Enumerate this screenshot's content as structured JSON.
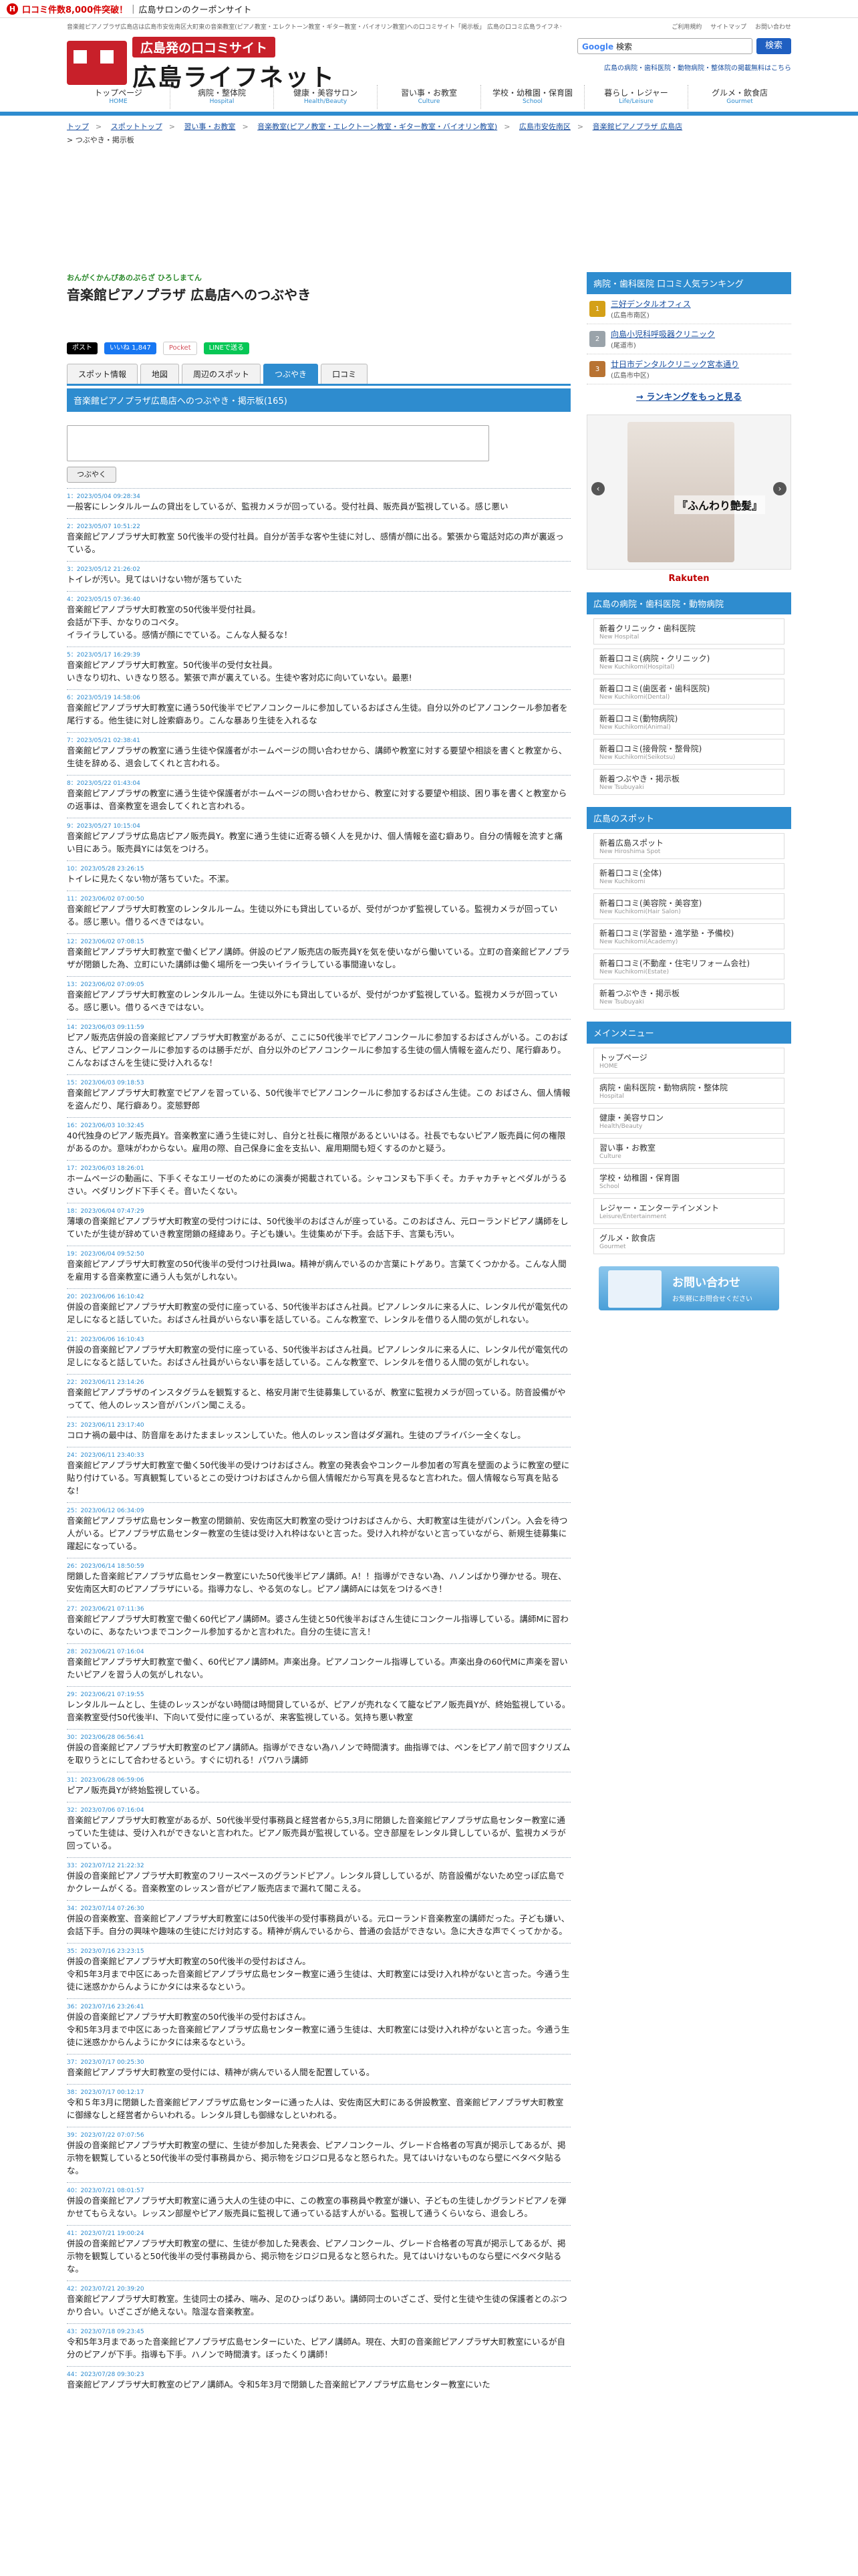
{
  "promo": {
    "text": "口コミ件数8,000件突破！",
    "sep": "|",
    "coupon": "広島サロンのクーポンサイト"
  },
  "header": {
    "desc": "音楽館ピアノプラザ広島店は広島市安佐南区大町東の音楽教室(ピアノ教室・エレクトーン教室・ギター教室・バイオリン教室)への口コミサイト「掲示板」 広島の口コミ広島ライフネット",
    "toplinks": [
      "ご利用規約",
      "サイトマップ",
      "お問い合わせ"
    ],
    "logo_tag": "広島発の口コミサイト",
    "logo_name": "広島ライフネット",
    "search_brand": "Google",
    "search_placeholder": "検索",
    "search_button": "検索",
    "hotlinks": "広島の病院・歯科医院・動物病院・整体院の掲載無料はこちら"
  },
  "gnav": [
    {
      "jp": "トップページ",
      "en": "HOME"
    },
    {
      "jp": "病院・整体院",
      "en": "Hospital"
    },
    {
      "jp": "健康・美容サロン",
      "en": "Health/Beauty"
    },
    {
      "jp": "習い事・お教室",
      "en": "Culture"
    },
    {
      "jp": "学校・幼稚園・保育園",
      "en": "School"
    },
    {
      "jp": "暮らし・レジャー",
      "en": "Life/Leisure"
    },
    {
      "jp": "グルメ・飲食店",
      "en": "Gourmet"
    }
  ],
  "breadcrumb": [
    "トップ",
    "スポットトップ",
    "習い事・お教室",
    "音楽教室(ピアノ教室・エレクトーン教室・ギター教室・バイオリン教室)",
    "広島市安佐南区",
    "音楽館ピアノプラザ 広島店"
  ],
  "breadcrumb_current": "つぶやき・掲示板",
  "breadcrumb_sep": ">",
  "page": {
    "kana": "おんがくかんぴあのぷらざ ひろしまてん",
    "title": "音楽館ピアノプラザ 広島店へのつぶやき"
  },
  "social": {
    "x": "ポスト",
    "fb": "いいね 1,847",
    "pocket": "Pocket",
    "line": "LINEで送る"
  },
  "tabs": [
    "スポット情報",
    "地図",
    "周辺のスポット",
    "つぶやき",
    "口コミ"
  ],
  "board": {
    "heading": "音楽館ピアノプラザ広島店へのつぶやき・掲示板(165)",
    "post_button": "つぶやく"
  },
  "posts": [
    {
      "meta": "1：2023/05/04 09:28:34",
      "body": "一般客にレンタルルームの貸出をしているが、監視カメラが回っている。受付社員、販売員が監視している。感じ悪い"
    },
    {
      "meta": "2：2023/05/07 10:51:22",
      "body": "音楽館ピアノプラザ大町教室 50代後半の受付社員。自分が苦手な客や生徒に対し、感情が顔に出る。繁張から電話対応の声が裏返っている。"
    },
    {
      "meta": "3：2023/05/12 21:26:02",
      "body": "トイレが汚い。見てはいけない物が落ちていた"
    },
    {
      "meta": "4：2023/05/15 07:36:40",
      "body": "音楽館ピアノプラザ大町教室の50代後半受付社員。\n会話が下手、かなりのコペタ。\nイライラしている。感情が顔にでている。こんな人擬るな！"
    },
    {
      "meta": "5：2023/05/17 16:29:39",
      "body": "音楽館ピアノプラザ大町教室。50代後半の受付女社員。\nいきなり切れ、いきなり怒る。繁張で声が裏えている。生徒や客対応に向いていない。最悪!"
    },
    {
      "meta": "6：2023/05/19 14:58:06",
      "body": "音楽館ピアノプラザ大町教室に通う50代後半でピアノコンクールに参加しているおばさん生徒。自分以外のピアノコンクール参加者を尾行する。他生徒に対し詮索癖あり。こんな暴あり生徒を入れるな"
    },
    {
      "meta": "7：2023/05/21 02:38:41",
      "body": "音楽館ピアノプラザの教室に通う生徒や保護者がホームページの問い合わせから、講師や教室に対する要望や相談を書くと教室から、生徒を辞める、退会してくれと言われる。"
    },
    {
      "meta": "8：2023/05/22 01:43:04",
      "body": "音楽館ピアノプラザの教室に通う生徒や保護者がホームページの問い合わせから、教室に対する要望や相談、困り事を書くと教室から の返事は、音楽教室を退会してくれと言われる。"
    },
    {
      "meta": "9：2023/05/27 10:15:04",
      "body": "音楽館ピアノプラザ広島店ピアノ販売員Y。教室に通う生徒に近寄る頓く人を見かけ、個人情報を盗む癖あり。自分の情報を流すと痛い目にあう。販売員Yには気をつけろ。"
    },
    {
      "meta": "10：2023/05/28 23:26:15",
      "body": "トイレに見たくない物が落ちていた。不潔。"
    },
    {
      "meta": "11：2023/06/02 07:00:50",
      "body": "音楽館ピアノプラザ大町教室のレンタルルーム。生徒以外にも貸出しているが、受付がつかず監視している。監視カメラが回っている。感じ悪い。借りるべきではない。"
    },
    {
      "meta": "12：2023/06/02 07:08:15",
      "body": "音楽館ピアノプラザ大町教室で働くピアノ講師。併設のピアノ販売店の販売員Yを気を使いながら働いている。立町の音楽館ピアノプラザが閉鎖した為、立町にいた講師は働く場所を一つ失いイライラしている事間違いなし。"
    },
    {
      "meta": "13：2023/06/02 07:09:05",
      "body": "音楽館ピアノプラザ大町教室のレンタルルーム。生徒以外にも貸出しているが、受付がつかず監視している。監視カメラが回っている。感じ悪い。借りるべきではない。"
    },
    {
      "meta": "14：2023/06/03 09:11:59",
      "body": "ピアノ販売店併設の音楽館ピアノプラザ大町教室があるが、ここに50代後半でピアノコンクールに参加するおばさんがいる。このおばさん、ピアノコンクールに参加するのは勝手だが、自分以外のピアノコンクールに参加する生徒の個人情報を盗んだり、尾行癖あり。こんなおばさんを生徒に受け入れるな！"
    },
    {
      "meta": "15：2023/06/03 09:18:53",
      "body": "音楽館ピアノプラザ大町教室でピアノを習っている、50代後半でピアノコンクールに参加するおばさん生徒。この おばさん、個人情報を盗んだり、尾行癖あり。変態野郎"
    },
    {
      "meta": "16：2023/06/03 10:32:45",
      "body": "40代独身のピアノ販売員Y。音楽教室に通う生徒に対し、自分と社長に権限があるといいはる。社長でもないピアノ販売員に何の権限があるのか。意味がわからない。雇用の際、自己保身に金を支払い、雇用期間も短くするのかと疑う。"
    },
    {
      "meta": "17：2023/06/03 18:26:01",
      "body": "ホームページの動画に、下手くそなエリーゼのためにの演奏が掲載されている。シャコンヌも下手くそ。カチャカチャとペダルがうるさい。ペダリングド下手くそ。音いたくない。"
    },
    {
      "meta": "18：2023/06/04 07:47:29",
      "body": "薄壊の音楽館ピアノプラザ大町教室の受付つけには、50代後半のおばさんが座っている。このおばさん、元ローランドピアノ講師をしていたが生徒が辞めていき教室閉鎖の経緯あり。子ども嫌い。生徒集めが下手。会話下手、言葉も汚い。"
    },
    {
      "meta": "19：2023/06/04 09:52:50",
      "body": "音楽館ピアノプラザ大町教室の50代後半の受付つけ社員Iwa。精神が病んでいるのか言葉にトゲあり。言葉てくつかかる。こんな人間を雇用する音楽教室に通う人も気がしれない。"
    },
    {
      "meta": "20：2023/06/06 16:10:42",
      "body": "併設の音楽館ピアノプラザ大町教室の受付に座っている、50代後半おばさん社員。ピアノレンタルに来る人に、レンタル代が電気代の足しになると話していた。おばさん社員がいらない事を話している。こんな教室で、レンタルを借りる人間の気がしれない。"
    },
    {
      "meta": "21：2023/06/06 16:10:43",
      "body": "併設の音楽館ピアノプラザ大町教室の受付に座っている、50代後半おばさん社員。ピアノレンタルに来る人に、レンタル代が電気代の足しになると話していた。おばさん社員がいらない事を話している。こんな教室で、レンタルを借りる人間の気がしれない。"
    },
    {
      "meta": "22：2023/06/11 23:14:26",
      "body": "音楽館ピアノプラザのインスタグラムを観覧すると、格安月謝で生徒募集しているが、教室に監視カメラが回っている。防音設備がやってて、他人のレッスン音がバンバン聞こえる。"
    },
    {
      "meta": "23：2023/06/11 23:17:40",
      "body": "コロナ禍の最中は、防音扉をあけたままレッスンしていた。他人のレッスン音はダダ漏れ。生徒のプライバシー全くなし。"
    },
    {
      "meta": "24：2023/06/11 23:40:33",
      "body": "音楽館ピアノプラザ大町教室で働く50代後半の受けつけおばさん。教室の発表会やコンクール参加者の写真を壁面のように教室の壁に貼り付けている。写真観覧しているとこの受けつけおばさんから個人情報だから写真を見るなと言われた。個人情報なら写真を貼るな！"
    },
    {
      "meta": "25：2023/06/12 06:34:09",
      "body": "音楽館ピアノプラザ広島センター教室の閉鎖前、安佐南区大町教室の受けつけおばさんから、大町教室は生徒がパンパン。入会を待つ人がいる。ピアノプラザ広島センター教室の生徒は受け入れ枠はないと言った。受け入れ枠がないと言っていながら、新規生徒募集に躍起になっている。"
    },
    {
      "meta": "26：2023/06/14 18:50:59",
      "body": "閉鎖した音楽館ピアノプラザ広島センター教室にいた50代後半ピアノ講師。A！！指導ができない為、ハノンばかり弾かせる。現在、安佐南区大町のピアノプラザにいる。指導力なし、やる気のなし。ピアノ講師Aには気をつけるべき！"
    },
    {
      "meta": "27：2023/06/21 07:11:36",
      "body": "音楽館ピアノプラザ大町教室で働く60代ピアノ講師M。婆さん生徒と50代後半おばさん生徒にコンクール指導している。講師Mに習わないのに、あなたいつまでコンクール参加するかと言われた。自分の生徒に言え！"
    },
    {
      "meta": "28：2023/06/21 07:16:04",
      "body": "音楽館ピアノプラザ大町教室で働く、60代ピアノ講師M。声楽出身。ピアノコンクール指導している。声楽出身の60代Mに声楽を習いたいピアノを習う人の気がしれない。"
    },
    {
      "meta": "29：2023/06/21 07:19:55",
      "body": "レンタルルームとし、生徒のレッスンがない時間は時間貸しているが、ピアノが売れなくて籠なピアノ販売員Yが、終始監視している。音楽教室受付50代後半I、下向いて受付に座っているが、来客監視している。気持ち悪い教室"
    },
    {
      "meta": "30：2023/06/28 06:56:41",
      "body": "併設の音楽館ピアノプラザ大町教室のピアノ講師A。指導ができない為ハノンで時間潰す。曲指導では、ペンをピアノ前で回すクリズムを取りうとにして合わせるという。すぐに切れる！パワハラ講師"
    },
    {
      "meta": "31：2023/06/28 06:59:06",
      "body": "ピアノ販売員Yが終始監視している。"
    },
    {
      "meta": "32：2023/07/06 07:16:04",
      "body": "音楽館ピアノプラザ大町教室があるが、50代後半受付事務員と経営者から5,3月に閉鎖した音楽館ピアノプラザ広島センター教室に通っていた生徒は、受け入れができないと言われた。ピアノ販売員が監視している。空き部屋をレンタル貸ししているが、監視カメラが回っている。"
    },
    {
      "meta": "33：2023/07/12 21:22:32",
      "body": "併設の音楽館ピアノプラザ大町教室のフリースペースのグランドピアノ。レンタル貸ししているが、防音設備がないため空っぽ広島でかクレームがくる。音楽教室のレッスン音がピアノ販売店まで漏れて聞こえる。"
    },
    {
      "meta": "34：2023/07/14 07:26:30",
      "body": "併設の音楽教室、音楽館ピアノプラザ大町教室には50代後半の受付事務員がいる。元ローランド音楽教室の講師だった。子ども嫌い、会話下手。自分の興味や趣味の生徒にだけ対応する。精神が病んでいるから、普通の会話ができない。急に大きな声でくってかかる。"
    },
    {
      "meta": "35：2023/07/16 23:23:15",
      "body": "併設の音楽館ピアノプラザ大町教室の50代後半の受付おばさん。\n令和5年3月まで中区にあった音楽館ピアノプラザ広島センター教室に通う生徒は、大町教室には受け入れ枠がないと言った。今通う生徒に迷惑かからんようにかタには来るなという。"
    },
    {
      "meta": "36：2023/07/16 23:26:41",
      "body": "併設の音楽館ピアノプラザ大町教室の50代後半の受付おばさん。\n令和5年3月まで中区にあった音楽館ピアノプラザ広島センター教室に通う生徒は、大町教室には受け入れ枠がないと言った。今通う生徒に迷惑かからんようにかタには来るなという。"
    },
    {
      "meta": "37：2023/07/17 00:25:30",
      "body": "音楽館ピアノプラザ大町教室の受付には、精神が病んでいる人間を配置している。"
    },
    {
      "meta": "38：2023/07/17 00:12:17",
      "body": "令和５年3月に閉鎖した音楽館ピアノプラザ広島センターに通った人は、安佐南区大町にある併設教室、音楽館ピアノプラザ大町教室に御縁なしと経営者からいわれる。レンタル貸しも御縁なしといわれる。"
    },
    {
      "meta": "39：2023/07/22 07:07:56",
      "body": "併設の音楽館ピアノプラザ大町教室の壁に、生徒が参加した発表会、ピアノコンクール、グレード合格者の写真が掲示してあるが、掲示物を観覧していると50代後半の受付事務員から、掲示物をジロジロ見るなと怒られた。見てはいけないものなら壁にベタベタ貼るな。"
    },
    {
      "meta": "40：2023/07/21 08:01:57",
      "body": "併設の音楽館ピアノプラザ大町教室に通う大人の生徒の中に、この教室の事務員や教室が嫌い、子どもの生徒しかグランドピアノを弾かせてもらえない。レッスン部屋やピアノ販売員に監視して通っている話す人がいる。監視して通うくらいなら、退会しろ。"
    },
    {
      "meta": "41：2023/07/21 19:00:24",
      "body": "併設の音楽館ピアノプラザ大町教室の壁に、生徒が参加した発表会、ピアノコンクール、グレード合格者の写真が掲示してあるが、掲示物を観覧していると50代後半の受付事務員から、掲示物をジロジロ見るなと怒られた。見てはいけないものなら壁にベタベタ貼るな。"
    },
    {
      "meta": "42：2023/07/21 20:39:20",
      "body": "音楽館ピアノプラザ大町教室。生徒同士の揉み、喘み、足のひっぱりあい。講師同士のいざこざ、受付と生徒や生徒の保護者とのぶつかり合い。いざこざが絶えない。陰湿な音楽教室。"
    },
    {
      "meta": "43：2023/07/18 09:23:45",
      "body": "令和5年3月まであった音楽館ピアノプラザ広島センターにいた、ピアノ講師A。現在、大町の音楽館ピアノプラザ大町教室にいるが自分のピアノが下手。指導も下手。ハノンで時間潰す。ぼったくり講師！"
    },
    {
      "meta": "44：2023/07/28 09:30:23",
      "body": "音楽館ピアノプラザ大町教室のピアノ講師A。令和5年3月で閉鎖した音楽館ピアノプラザ広島センター教室にいた"
    }
  ],
  "side": {
    "ranking_head": "病院・歯科医院 口コミ人気ランキング",
    "ranking": [
      {
        "name": "三好デンタルオフィス",
        "area": "(広島市南区)",
        "color": "#d4a017"
      },
      {
        "name": "向島小児科呼吸器クリニック",
        "area": "(尾道市)",
        "color": "#9aa3aa"
      },
      {
        "name": "廿日市デンタルクリニック宮本通り",
        "area": "(広島市中区)",
        "color": "#b87333"
      }
    ],
    "ranking_more": "→ ランキングをもっと見る",
    "ad_text": "『ふんわり艶髪』",
    "rakuten": "Rakuten",
    "recent_head": "広島の病院・歯科医院・動物病院",
    "recent": [
      {
        "jp": "新着クリニック・歯科医院",
        "en": "New Hospital"
      },
      {
        "jp": "新着口コミ(病院・クリニック)",
        "en": "New Kuchikomi(Hospital)"
      },
      {
        "jp": "新着口コミ(歯医者・歯科医院)",
        "en": "New Kuchikomi(Dental)"
      },
      {
        "jp": "新着口コミ(動物病院)",
        "en": "New Kuchikomi(Animal)"
      },
      {
        "jp": "新着口コミ(接骨院・整骨院)",
        "en": "New Kuchikomi(Seikotsu)"
      },
      {
        "jp": "新着つぶやき・掲示板",
        "en": "New Tsubuyaki"
      }
    ],
    "spot_head": "広島のスポット",
    "spots": [
      {
        "jp": "新着広島スポット",
        "en": "New Hiroshima Spot"
      },
      {
        "jp": "新着口コミ(全体)",
        "en": "New Kuchikomi"
      },
      {
        "jp": "新着口コミ(美容院・美容室)",
        "en": "New Kuchikomi(Hair Salon)"
      },
      {
        "jp": "新着口コミ(学習塾・進学塾・予備校)",
        "en": "New Kuchikomi(Academy)"
      },
      {
        "jp": "新着口コミ(不動産・住宅リフォーム会社)",
        "en": "New Kuchikomi(Estate)"
      },
      {
        "jp": "新着つぶやき・掲示板",
        "en": "New Tsubuyaki"
      }
    ],
    "menu_head": "メインメニュー",
    "menu": [
      {
        "jp": "トップページ",
        "en": "HOME"
      },
      {
        "jp": "病院・歯科医院・動物病院・整体院",
        "en": "Hospital"
      },
      {
        "jp": "健康・美容サロン",
        "en": "Health/Beauty"
      },
      {
        "jp": "習い事・お教室",
        "en": "Culture"
      },
      {
        "jp": "学校・幼稚園・保育園",
        "en": "School"
      },
      {
        "jp": "レジャー・エンターテインメント",
        "en": "Leisure/Entertainment"
      },
      {
        "jp": "グルメ・飲食店",
        "en": "Gourmet"
      }
    ],
    "contact_title": "お問い合わせ",
    "contact_sub": "お気軽にお問合せください"
  }
}
